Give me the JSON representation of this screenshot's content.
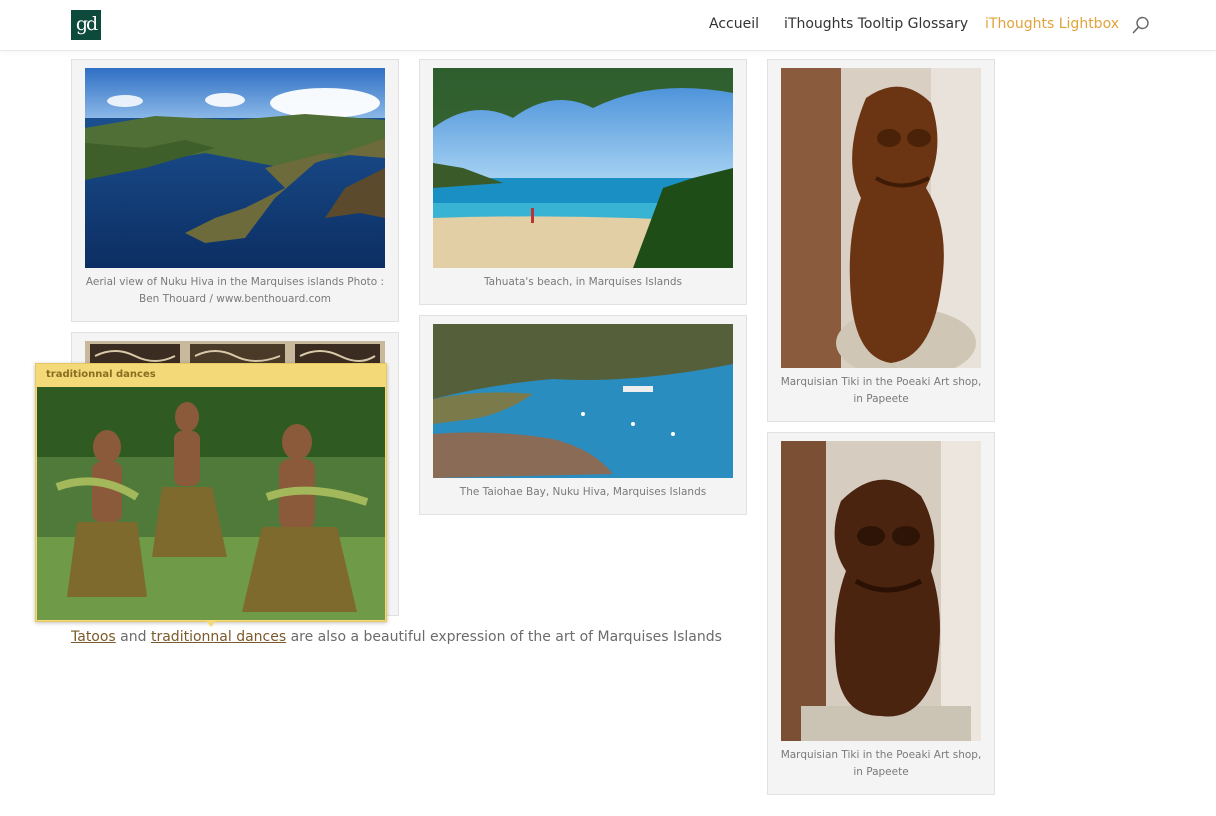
{
  "header": {
    "logo_text": "gd",
    "nav": [
      {
        "label": "Accueil",
        "active": false
      },
      {
        "label": "iThoughts Tooltip Glossary",
        "active": false
      },
      {
        "label": "iThoughts Lightbox",
        "active": true
      }
    ],
    "search_icon": "search-icon"
  },
  "gallery": [
    {
      "caption": "Aerial view of Nuku Hiva in the Marquises islands Photo : Ben Thouard / www.benthouard.com",
      "image": "aerial-bay-photo"
    },
    {
      "caption": "Tahuata's beach, in Marquises Islands",
      "image": "beach-palm-photo"
    },
    {
      "caption": "Marquisian Tiki in the Poeaki Art shop, in Papeete",
      "image": "tiki-statue-photo"
    },
    {
      "caption": "The Taiohae Bay, Nuku Hiva, Marquises Islands",
      "image": "bay-harbor-photo"
    },
    {
      "caption": "Marquisian Tiki in the Poeaki Art shop, in Papeete",
      "image": "tiki-statue-photo"
    },
    {
      "caption": "",
      "image": "tattoo-carvings-photo"
    }
  ],
  "tooltip": {
    "title": "traditionnal dances",
    "image": "dancers-photo"
  },
  "paragraph": {
    "link1": "Tatoos",
    "and": " and ",
    "link2": "traditionnal dances",
    "rest": " are also a beautiful expression of the art of Marquises Islands"
  },
  "colors": {
    "accent": "#e0a33c",
    "logo_bg": "#0d4a3b",
    "tooltip_bg": "#f3d977"
  }
}
